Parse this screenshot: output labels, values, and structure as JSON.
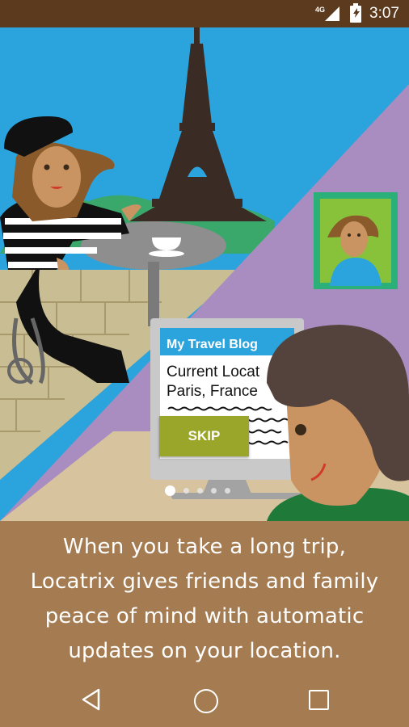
{
  "status_bar": {
    "network": "4G",
    "time": "3:07",
    "icons": [
      "signal-icon",
      "battery-charging-icon"
    ]
  },
  "illustration": {
    "blog_title": "My Travel Blog",
    "blog_line1": "Current Locat",
    "blog_line2": "Paris, France"
  },
  "skip_button": {
    "label": "SKIP"
  },
  "pager": {
    "total": 5,
    "active_index": 0
  },
  "caption": {
    "lines": [
      "When you take a long trip,",
      "Locatrix gives friends and family",
      "peace of mind with automatic",
      "updates on your location."
    ]
  },
  "nav_bar": {
    "icons": [
      "back-icon",
      "home-icon",
      "recents-icon"
    ]
  },
  "colors": {
    "status_bar": "#5b3a1e",
    "caption_background": "#a57c52",
    "sky": "#2ba3dd",
    "purple": "#a98cc0",
    "skip_button": "#9aa629"
  }
}
